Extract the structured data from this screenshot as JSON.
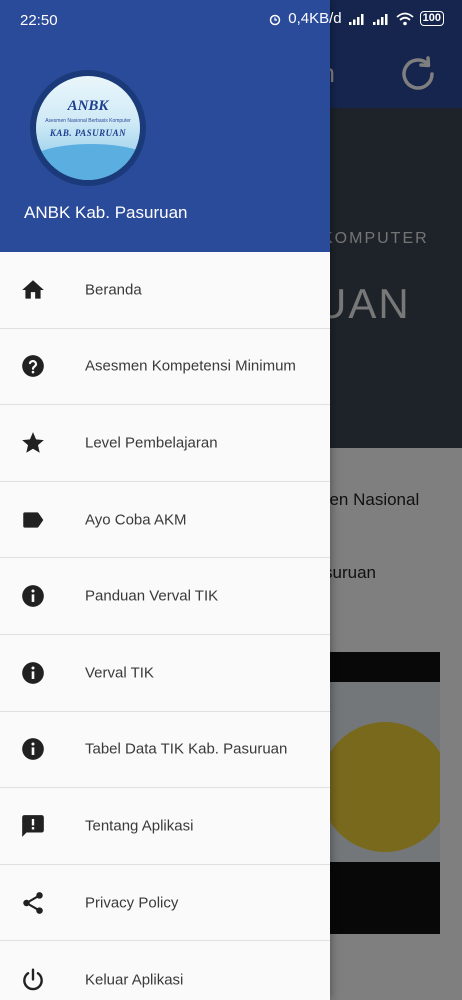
{
  "status_bar": {
    "time": "22:50",
    "network_speed": "0,4KB/d",
    "battery": "100",
    "icons": [
      "alarm-icon",
      "signal-icon",
      "signal-icon",
      "wifi-icon",
      "battery-icon"
    ]
  },
  "drawer": {
    "logo": {
      "title": "ANBK",
      "tagline": "Asesmen Nasional Berbasis Komputer",
      "subtitle": "KAB. PASURUAN"
    },
    "app_name": "ANBK Kab. Pasuruan",
    "items": [
      {
        "label": "Beranda",
        "icon": "home-icon"
      },
      {
        "label": "Asesmen Kompetensi Minimum",
        "icon": "help-icon"
      },
      {
        "label": "Level Pembelajaran",
        "icon": "star-icon"
      },
      {
        "label": "Ayo Coba AKM",
        "icon": "label-tag-icon"
      },
      {
        "label": "Panduan Verval TIK",
        "icon": "info-icon"
      },
      {
        "label": "Verval TIK",
        "icon": "info-icon"
      },
      {
        "label": "Tabel Data TIK Kab. Pasuruan",
        "icon": "info-icon"
      },
      {
        "label": "Tentang Aplikasi",
        "icon": "feedback-icon"
      },
      {
        "label": "Privacy Policy",
        "icon": "share-icon"
      },
      {
        "label": "Keluar Aplikasi",
        "icon": "power-icon"
      }
    ]
  },
  "background": {
    "appbar_title_fragment": "an",
    "hero_subtitle_fragment": "KOMPUTER",
    "hero_title_fragment": "UAN",
    "text_fragment_1": "nen Nasional",
    "text_fragment_2": "suruan"
  },
  "colors": {
    "primary": "#2a4a9a",
    "drawer_bg": "#fafafa",
    "icon": "#212121"
  }
}
